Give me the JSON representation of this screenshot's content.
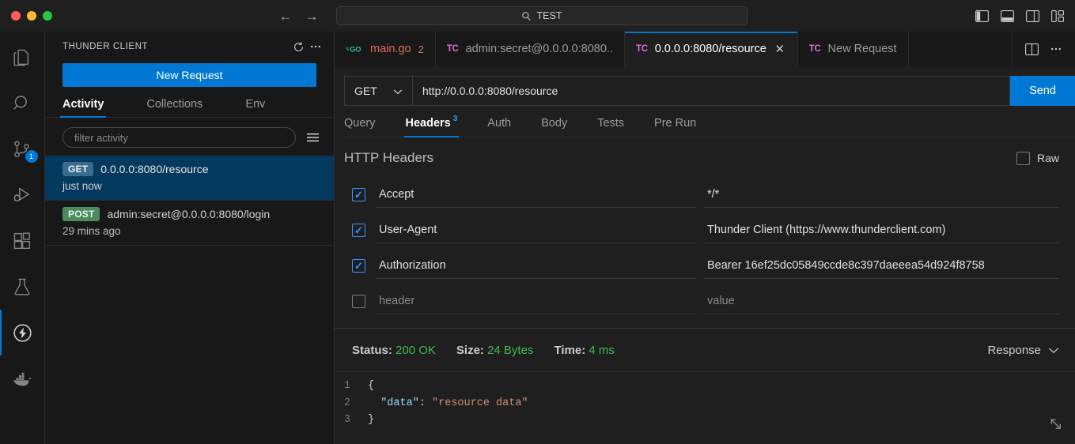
{
  "titlebar": {
    "command_center_text": "TEST",
    "command_center_icon": "search-icon",
    "back_icon": "arrow-left-icon",
    "forward_icon": "arrow-right-icon",
    "layout_icons": [
      "toggle-primary-sidebar-icon",
      "toggle-panel-icon",
      "toggle-secondary-sidebar-icon",
      "customize-layout-icon"
    ]
  },
  "activitybar": {
    "items": [
      {
        "name": "explorer",
        "icon": "files-icon",
        "active": false,
        "badge": ""
      },
      {
        "name": "search",
        "icon": "search-icon",
        "active": false,
        "badge": ""
      },
      {
        "name": "source-control",
        "icon": "source-control-icon",
        "active": false,
        "badge": "1"
      },
      {
        "name": "run-and-debug",
        "icon": "debug-icon",
        "active": false,
        "badge": ""
      },
      {
        "name": "extensions",
        "icon": "extensions-icon",
        "active": false,
        "badge": ""
      },
      {
        "name": "testing",
        "icon": "beaker-icon",
        "active": false,
        "badge": ""
      },
      {
        "name": "thunder-client",
        "icon": "thunder-bolt-icon",
        "active": true,
        "badge": ""
      },
      {
        "name": "docker",
        "icon": "docker-whale-icon",
        "active": false,
        "badge": ""
      }
    ]
  },
  "sidebar": {
    "title": "THUNDER CLIENT",
    "refresh_icon": "refresh-icon",
    "more_icon": "more-actions-icon",
    "new_request_label": "New Request",
    "tabs": [
      {
        "label": "Activity",
        "active": true
      },
      {
        "label": "Collections",
        "active": false
      },
      {
        "label": "Env",
        "active": false
      }
    ],
    "filter_placeholder": "filter activity",
    "filter_value": "",
    "filter_menu_icon": "filter-list-icon",
    "activity_items": [
      {
        "method": "GET",
        "url": "0.0.0.0:8080/resource",
        "time": "just now",
        "selected": true
      },
      {
        "method": "POST",
        "url": "admin:secret@0.0.0.0:8080/login",
        "time": "29 mins ago",
        "selected": false
      }
    ]
  },
  "editor": {
    "tabs": [
      {
        "label": "main.go",
        "icon": "go-lang-icon",
        "count": "2",
        "active": false,
        "closable": false,
        "modified": true
      },
      {
        "label": "admin:secret@0.0.0.0:8080..",
        "icon": "thunder-client-tab-icon",
        "count": "",
        "active": false,
        "closable": false,
        "modified": false
      },
      {
        "label": "0.0.0.0:8080/resource",
        "icon": "thunder-client-tab-icon",
        "count": "",
        "active": true,
        "closable": true,
        "modified": false
      },
      {
        "label": "New Request",
        "icon": "thunder-client-tab-icon",
        "count": "",
        "active": false,
        "closable": false,
        "modified": false
      }
    ],
    "close_icon": "close-icon",
    "split_editor_icon": "split-editor-icon",
    "editor_more_icon": "more-actions-icon"
  },
  "request": {
    "method": "GET",
    "method_chevron_icon": "chevron-down-icon",
    "url": "http://0.0.0.0:8080/resource",
    "send_label": "Send",
    "tabs": [
      {
        "label": "Query",
        "badge": "",
        "active": false
      },
      {
        "label": "Headers",
        "badge": "3",
        "active": true
      },
      {
        "label": "Auth",
        "badge": "",
        "active": false
      },
      {
        "label": "Body",
        "badge": "",
        "active": false
      },
      {
        "label": "Tests",
        "badge": "",
        "active": false
      },
      {
        "label": "Pre Run",
        "badge": "",
        "active": false
      }
    ],
    "headers_title": "HTTP Headers",
    "raw_label": "Raw",
    "raw_checked": false,
    "headers": [
      {
        "checked": true,
        "key": "Accept",
        "value": "*/*",
        "placeholder_key": "",
        "placeholder_value": ""
      },
      {
        "checked": true,
        "key": "User-Agent",
        "value": "Thunder Client (https://www.thunderclient.com)",
        "placeholder_key": "",
        "placeholder_value": ""
      },
      {
        "checked": true,
        "key": "Authorization",
        "value": "Bearer 16ef25dc05849ccde8c397daeeea54d924f8758",
        "placeholder_key": "",
        "placeholder_value": ""
      },
      {
        "checked": false,
        "key": "",
        "value": "",
        "placeholder_key": "header",
        "placeholder_value": "value"
      }
    ]
  },
  "response": {
    "status_label": "Status:",
    "status_value": "200 OK",
    "size_label": "Size:",
    "size_value": "24 Bytes",
    "time_label": "Time:",
    "time_value": "4 ms",
    "toggle_label": "Response",
    "toggle_icon": "chevron-down-icon",
    "resize_icon": "resize-expand-icon",
    "status_color": "#3fb950",
    "body_lines": [
      {
        "num": "1",
        "segments": [
          {
            "t": "{",
            "c": "tok-punct"
          }
        ]
      },
      {
        "num": "2",
        "segments": [
          {
            "t": "  ",
            "c": "tok-punct"
          },
          {
            "t": "\"data\"",
            "c": "tok-key"
          },
          {
            "t": ": ",
            "c": "tok-punct"
          },
          {
            "t": "\"resource data\"",
            "c": "tok-str"
          }
        ]
      },
      {
        "num": "3",
        "segments": [
          {
            "t": "}",
            "c": "tok-punct"
          }
        ]
      }
    ]
  },
  "colors": {
    "accent": "#0078d4",
    "selection": "#04395e",
    "success": "#3fb950",
    "badge": "#3794ff"
  }
}
